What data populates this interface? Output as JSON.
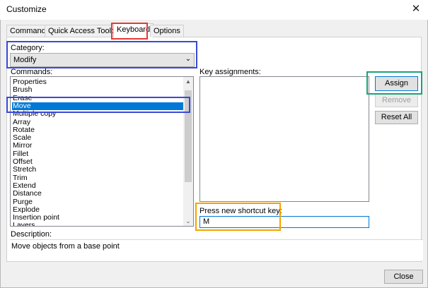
{
  "window": {
    "title": "Customize",
    "close_glyph": "✕"
  },
  "tabs": [
    {
      "label": "Commands"
    },
    {
      "label": "Quick Access Toolbar"
    },
    {
      "label": "Keyboard"
    },
    {
      "label": "Options"
    }
  ],
  "category": {
    "label": "Category:",
    "value": "Modify"
  },
  "commands": {
    "label": "Commands:",
    "items": [
      "Properties",
      "Brush",
      "Erase",
      "Move",
      "Multiple copy",
      "Array",
      "Rotate",
      "Scale",
      "Mirror",
      "Fillet",
      "Offset",
      "Stretch",
      "Trim",
      "Extend",
      "Distance",
      "Purge",
      "Explode",
      "Insertion point",
      "Layers"
    ],
    "selected": "Move"
  },
  "key_assignments": {
    "label": "Key assignments:"
  },
  "shortcut": {
    "label": "Press new shortcut key:",
    "value": "M"
  },
  "buttons": {
    "assign": "Assign",
    "remove": "Remove",
    "reset_all": "Reset All",
    "close": "Close"
  },
  "description": {
    "label": "Description:",
    "text": "Move objects from a base point"
  },
  "colors": {
    "highlight_red": "#e53935",
    "highlight_blue": "#3949d6",
    "highlight_green": "#1aa37a",
    "highlight_orange": "#f4a300",
    "selection": "#0078d7"
  }
}
